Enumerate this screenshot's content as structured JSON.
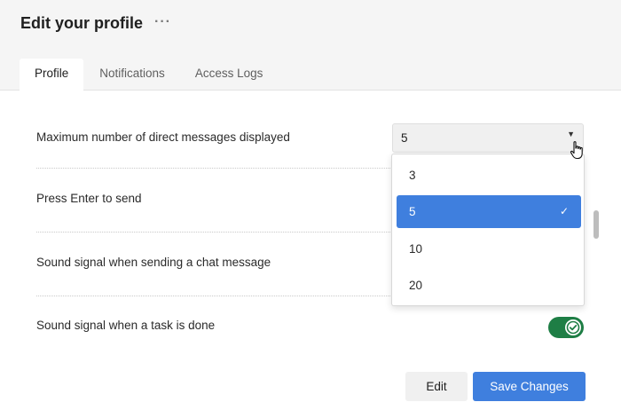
{
  "header": {
    "title": "Edit your profile",
    "more_label": "···"
  },
  "tabs": [
    {
      "label": "Profile",
      "active": true
    },
    {
      "label": "Notifications",
      "active": false
    },
    {
      "label": "Access Logs",
      "active": false
    }
  ],
  "settings": [
    {
      "label": "Maximum number of direct messages displayed"
    },
    {
      "label": "Press Enter to send"
    },
    {
      "label": "Sound signal when sending a chat message"
    },
    {
      "label": "Sound signal when a task is done"
    }
  ],
  "select": {
    "value": "5",
    "caret": "▼",
    "options": [
      "3",
      "5",
      "10",
      "20"
    ],
    "selected_index": 1,
    "check": "✓"
  },
  "toggle": {
    "on": true,
    "color": "#1e7e45"
  },
  "buttons": {
    "edit_label": "Edit",
    "save_label": "Save Changes"
  },
  "colors": {
    "accent": "#3f7fde",
    "toggle_on": "#1e7e45"
  }
}
